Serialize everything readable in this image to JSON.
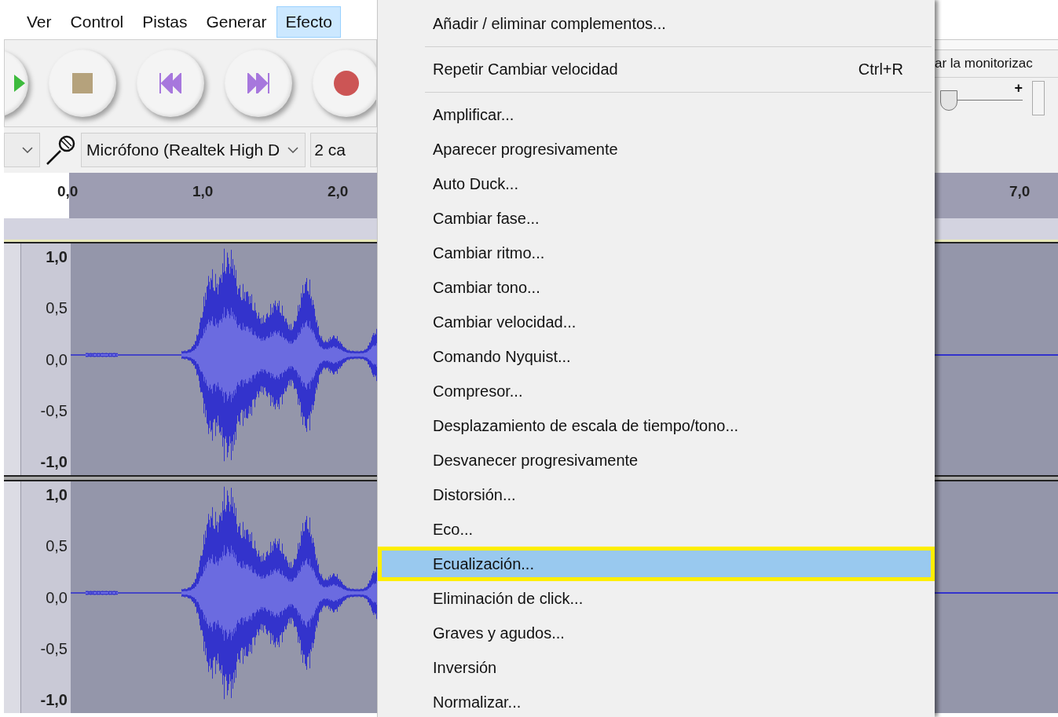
{
  "menubar": [
    {
      "label": "Ver",
      "selected": false
    },
    {
      "label": "Control",
      "selected": false
    },
    {
      "label": "Pistas",
      "selected": false
    },
    {
      "label": "Generar",
      "selected": false
    },
    {
      "label": "Efecto",
      "selected": true
    }
  ],
  "device": {
    "microphone": "Micrófono (Realtek High D",
    "channels": "2 ca"
  },
  "ruler": {
    "left_labels": [
      "0,0",
      "1,0",
      "2,0"
    ],
    "right_label": "7,0"
  },
  "monitor_label": "ar la monitorizac",
  "gain_slider": {
    "label": "+",
    "level": 0.05
  },
  "tracks": [
    {
      "scale": [
        "1,0",
        "0,5",
        "0,0",
        "-0,5",
        "-1,0"
      ]
    },
    {
      "scale": [
        "1,0",
        "0,5",
        "0,0",
        "-0,5",
        "-1,0"
      ]
    }
  ],
  "effect_menu": [
    {
      "kind": "item",
      "label": "Añadir / eliminar complementos...",
      "selected": false
    },
    {
      "kind": "separator"
    },
    {
      "kind": "item",
      "label": "Repetir Cambiar velocidad",
      "shortcut": "Ctrl+R",
      "selected": false
    },
    {
      "kind": "separator"
    },
    {
      "kind": "item",
      "label": "Amplificar...",
      "selected": false
    },
    {
      "kind": "item",
      "label": "Aparecer progresivamente",
      "selected": false
    },
    {
      "kind": "item",
      "label": "Auto Duck...",
      "selected": false
    },
    {
      "kind": "item",
      "label": "Cambiar fase...",
      "selected": false
    },
    {
      "kind": "item",
      "label": "Cambiar ritmo...",
      "selected": false
    },
    {
      "kind": "item",
      "label": "Cambiar tono...",
      "selected": false
    },
    {
      "kind": "item",
      "label": "Cambiar velocidad...",
      "selected": false
    },
    {
      "kind": "item",
      "label": "Comando Nyquist...",
      "selected": false
    },
    {
      "kind": "item",
      "label": "Compresor...",
      "selected": false
    },
    {
      "kind": "item",
      "label": "Desplazamiento de escala de tiempo/tono...",
      "selected": false
    },
    {
      "kind": "item",
      "label": "Desvanecer progresivamente",
      "selected": false
    },
    {
      "kind": "item",
      "label": "Distorsión...",
      "selected": false
    },
    {
      "kind": "item",
      "label": "Eco...",
      "selected": false
    },
    {
      "kind": "item",
      "label": "Ecualización...",
      "selected": true
    },
    {
      "kind": "item",
      "label": "Eliminación de click...",
      "selected": false
    },
    {
      "kind": "item",
      "label": "Graves y agudos...",
      "selected": false
    },
    {
      "kind": "item",
      "label": "Inversión",
      "selected": false
    },
    {
      "kind": "item",
      "label": "Normalizar...",
      "selected": false
    }
  ]
}
